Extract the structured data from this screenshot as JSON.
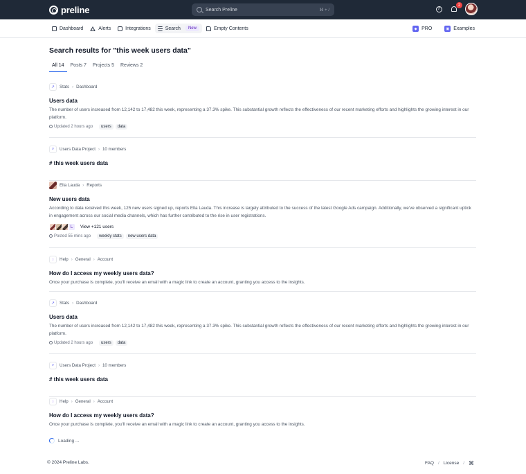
{
  "topbar": {
    "logo_text": "preline",
    "search_placeholder": "Search Preline",
    "search_shortcut": "⌘ + /",
    "notification_count": "2"
  },
  "nav": {
    "items": [
      {
        "label": "Dashboard",
        "icon": "dashboard-icon"
      },
      {
        "label": "Alerts",
        "icon": "alert-triangle-icon"
      },
      {
        "label": "Integrations",
        "icon": "puzzle-icon"
      },
      {
        "label": "Search",
        "icon": "search-list-icon",
        "badge": "New"
      },
      {
        "label": "Empty Contents",
        "icon": "file-icon"
      }
    ],
    "right": [
      {
        "label": "PRO",
        "icon": "pro-icon"
      },
      {
        "label": "Examples",
        "icon": "examples-icon"
      }
    ]
  },
  "page": {
    "title": "Search results for \"this week users data\"",
    "tabs": [
      "All 14",
      "Posts 7",
      "Projects 5",
      "Reviews 2"
    ]
  },
  "results": [
    {
      "crumb": [
        "Stats",
        "Dashboard"
      ],
      "icon": "trending-up-icon",
      "title": "Users data",
      "text": "The number of users increased from 12,142 to 17,482 this week, representing a 37.3% spike. This substantial growth reflects the effectiveness of our recent marketing efforts and highlights the growing interest in our platform.",
      "meta": "Updated 2 hours ago",
      "tags": [
        "users",
        "data"
      ]
    },
    {
      "crumb": [
        "Users Data Project",
        "10 members"
      ],
      "icon": "search-icon",
      "title": "# this week users data"
    },
    {
      "crumb": [
        "Ella Lauda",
        "Reports"
      ],
      "icon": "user-avatar",
      "title": "New users data",
      "text": "According to data received this week, 125 new users signed up, reports Ella Lauda. This increase is largely attributed to the success of the latest Google Ads campaign. Additionally, we've observed a significant uptick in engagement across our social media channels, which has further contributed to the rise in user registrations.",
      "avatar_letter": "L",
      "view_users": "View +121 users",
      "meta": "Posted 55 mins ago",
      "tags": [
        "weekly stats",
        "new users data"
      ]
    },
    {
      "crumb": [
        "Help",
        "General",
        "Account"
      ],
      "icon": "help-circle-icon",
      "title": "How do I access my weekly users data?",
      "text": "Once your purchase is complete, you'll receive an email with a magic link to create an account, granting you access to the insights."
    },
    {
      "crumb": [
        "Stats",
        "Dashboard"
      ],
      "icon": "trending-up-icon",
      "title": "Users data",
      "text": "The number of users increased from 12,142 to 17,482 this week, representing a 37.3% spike. This substantial growth reflects the effectiveness of our recent marketing efforts and highlights the growing interest in our platform.",
      "meta": "Updated 2 hours ago",
      "tags": [
        "users",
        "data"
      ]
    },
    {
      "crumb": [
        "Users Data Project",
        "10 members"
      ],
      "icon": "search-icon",
      "title": "# this week users data"
    },
    {
      "crumb": [
        "Help",
        "General",
        "Account"
      ],
      "icon": "help-circle-icon",
      "title": "How do I access my weekly users data?",
      "text": "Once your purchase is complete, you'll receive an email with a magic link to create an account, granting you access to the insights."
    }
  ],
  "loading_text": "Loading ...",
  "footer": {
    "copyright": "© 2024 Preline Labs.",
    "links": [
      "FAQ",
      "License"
    ]
  },
  "colors": {
    "topbar_bg": "#1f2937",
    "accent": "#2563eb",
    "badge_bg": "#ede9fe",
    "notif": "#ef4444"
  }
}
